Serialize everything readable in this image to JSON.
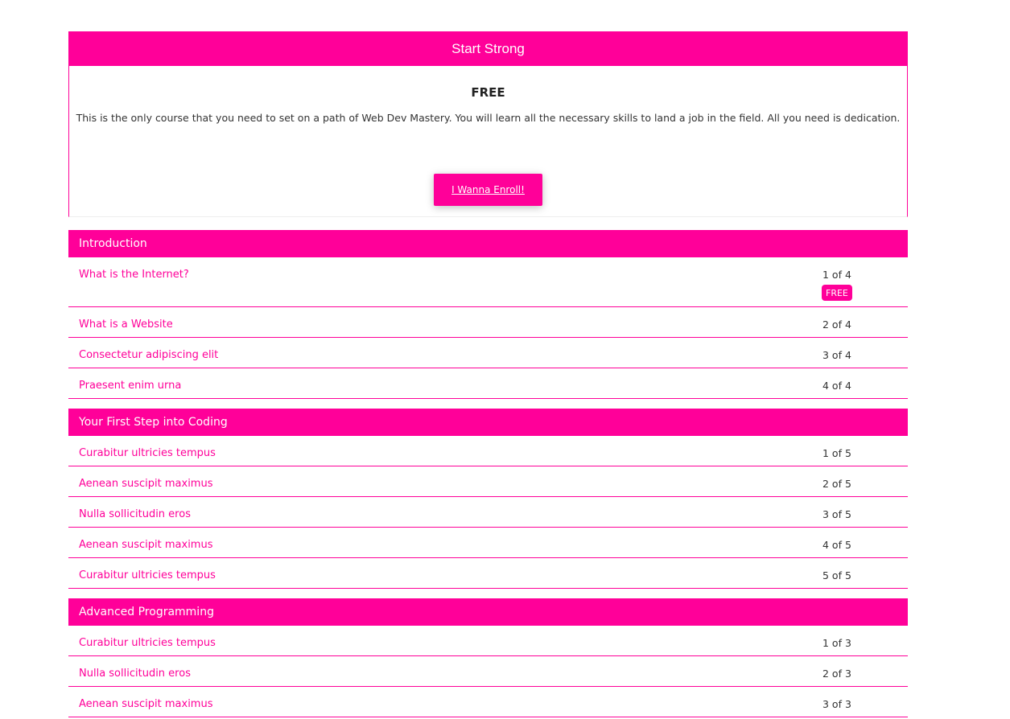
{
  "course": {
    "title": "Start Strong",
    "price": "FREE",
    "description": "This is the only course that you need to set on a path of Web Dev Mastery. You will learn all the necessary skills to land a job in the field. All you need is dedication.",
    "enroll_label": "I Wanna Enroll!"
  },
  "colors": {
    "accent": "#ff0099",
    "text": "#333333"
  },
  "sections": [
    {
      "title": "Introduction",
      "lessons": [
        {
          "title": "What is the Internet?",
          "count": "1 of 4",
          "badge": "FREE"
        },
        {
          "title": "What is a Website",
          "count": "2 of 4"
        },
        {
          "title": "Consectetur adipiscing elit",
          "count": "3 of 4"
        },
        {
          "title": "Praesent enim urna",
          "count": "4 of 4"
        }
      ]
    },
    {
      "title": "Your First Step into Coding",
      "lessons": [
        {
          "title": "Curabitur ultricies tempus",
          "count": "1 of 5"
        },
        {
          "title": "Aenean suscipit maximus",
          "count": "2 of 5"
        },
        {
          "title": "Nulla sollicitudin eros",
          "count": "3 of 5"
        },
        {
          "title": "Aenean suscipit maximus",
          "count": "4 of 5"
        },
        {
          "title": "Curabitur ultricies tempus",
          "count": "5 of 5"
        }
      ]
    },
    {
      "title": "Advanced Programming",
      "lessons": [
        {
          "title": "Curabitur ultricies tempus",
          "count": "1 of 3"
        },
        {
          "title": "Nulla sollicitudin eros",
          "count": "2 of 3"
        },
        {
          "title": "Aenean suscipit maximus",
          "count": "3 of 3"
        }
      ]
    }
  ]
}
